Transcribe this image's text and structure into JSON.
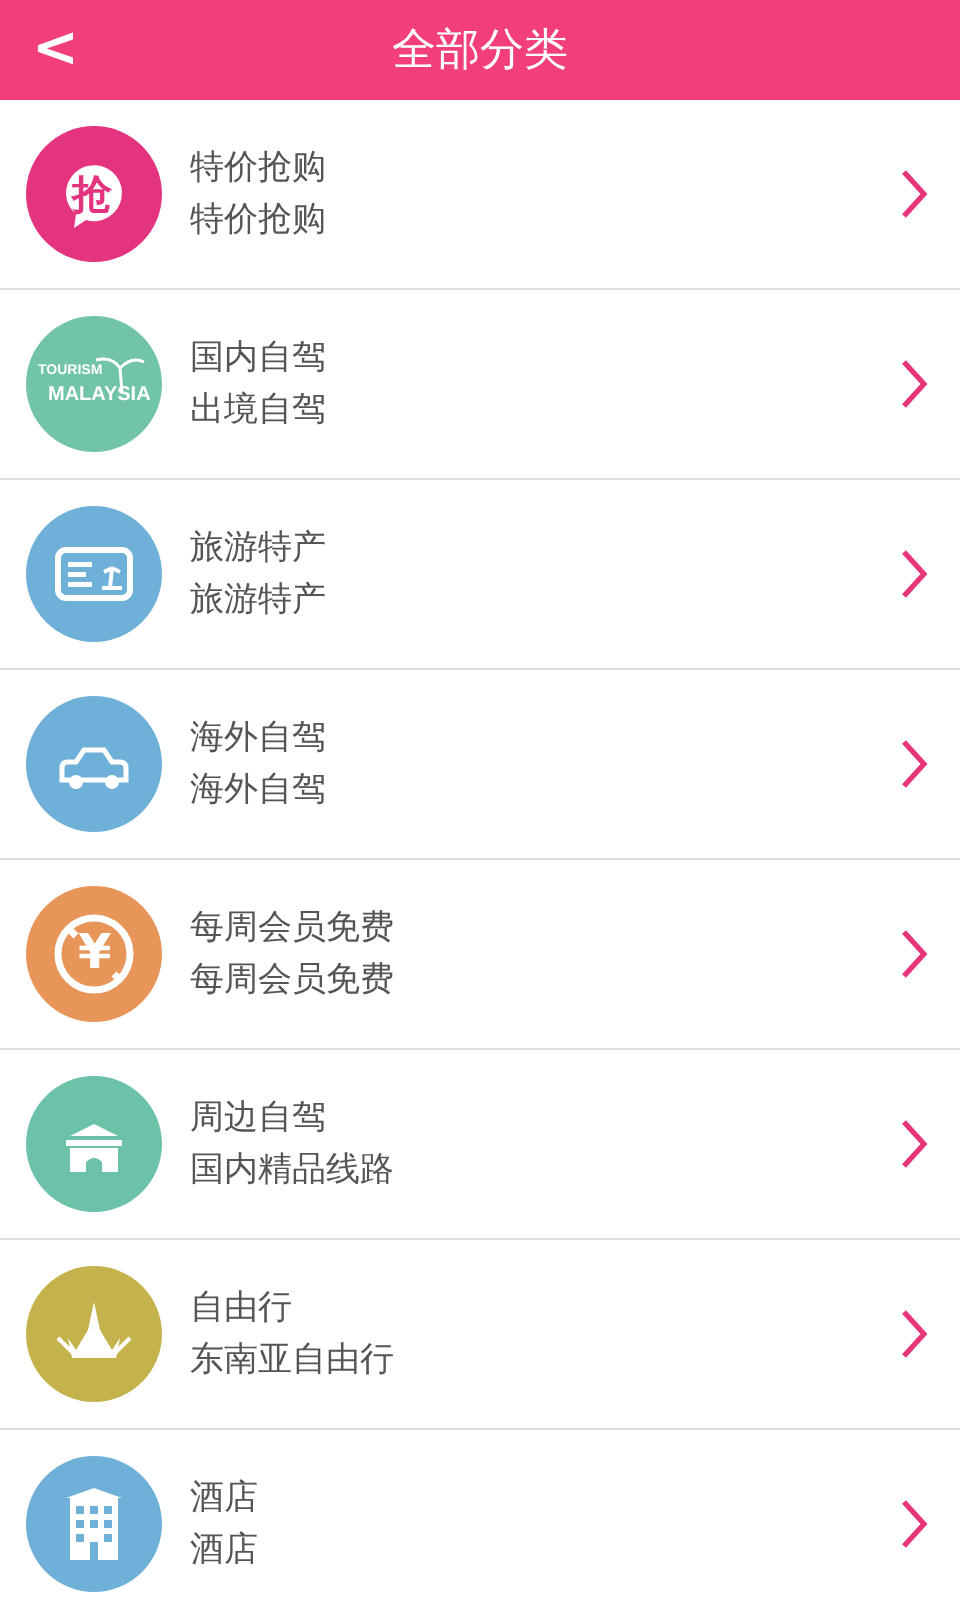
{
  "header": {
    "back": "<",
    "title": "全部分类"
  },
  "categories": [
    {
      "kind": "grab",
      "color": "#e4347f",
      "badge_text": "抢",
      "title": "特价抢购",
      "subtitle": "特价抢购"
    },
    {
      "kind": "logo",
      "color": "#72c4a9",
      "badge_text": "TOURISM",
      "badge_text_2": "MALAYSIA",
      "title": "国内自驾",
      "subtitle": "出境自驾"
    },
    {
      "kind": "card",
      "color": "#6fb0d9",
      "title": "旅游特产",
      "subtitle": "旅游特产"
    },
    {
      "kind": "car",
      "color": "#6fb0d9",
      "title": "海外自驾",
      "subtitle": "海外自驾"
    },
    {
      "kind": "yen",
      "color": "#e8955a",
      "badge_text": "¥",
      "title": "每周会员免费",
      "subtitle": "每周会员免费"
    },
    {
      "kind": "gate",
      "color": "#6cc2a8",
      "title": "周边自驾",
      "subtitle": "国内精品线路"
    },
    {
      "kind": "temple",
      "color": "#c4b24c",
      "title": "自由行",
      "subtitle": "东南亚自由行"
    },
    {
      "kind": "hotel",
      "color": "#6fb0d9",
      "title": "酒店",
      "subtitle": "酒店"
    }
  ]
}
